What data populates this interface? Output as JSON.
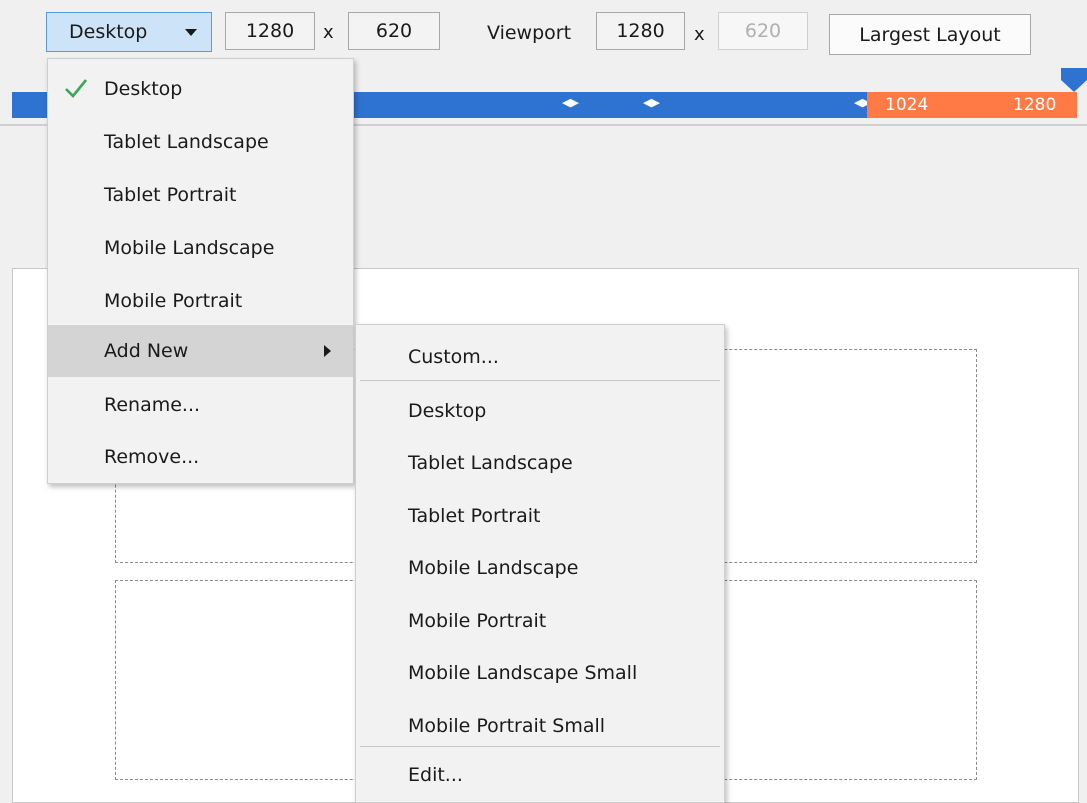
{
  "toolbar": {
    "device_label": "Desktop",
    "width_value": "1280",
    "times_1": "x",
    "height_value": "620",
    "viewport_label": "Viewport",
    "viewport_width": "1280",
    "times_2": "x",
    "viewport_height": "620",
    "largest_layout_label": "Largest Layout"
  },
  "ruler": {
    "label_1024": "1024",
    "label_1280": "1280",
    "colors": {
      "blue": "#2f73d1",
      "orange": "#ff7a45"
    }
  },
  "device_menu": {
    "items": [
      {
        "label": "Desktop",
        "checked": true
      },
      {
        "label": "Tablet Landscape"
      },
      {
        "label": "Tablet Portrait"
      },
      {
        "label": "Mobile Landscape"
      },
      {
        "label": "Mobile Portrait"
      },
      {
        "label": "Add New",
        "has_submenu": true
      },
      {
        "label": "Rename..."
      },
      {
        "label": "Remove..."
      }
    ]
  },
  "add_new_submenu": {
    "items": [
      {
        "label": "Custom..."
      },
      {
        "label": "Desktop"
      },
      {
        "label": "Tablet Landscape"
      },
      {
        "label": "Tablet Portrait"
      },
      {
        "label": "Mobile Landscape"
      },
      {
        "label": "Mobile Portrait"
      },
      {
        "label": "Mobile Landscape Small"
      },
      {
        "label": "Mobile Portrait Small"
      },
      {
        "label": "Edit..."
      }
    ]
  }
}
